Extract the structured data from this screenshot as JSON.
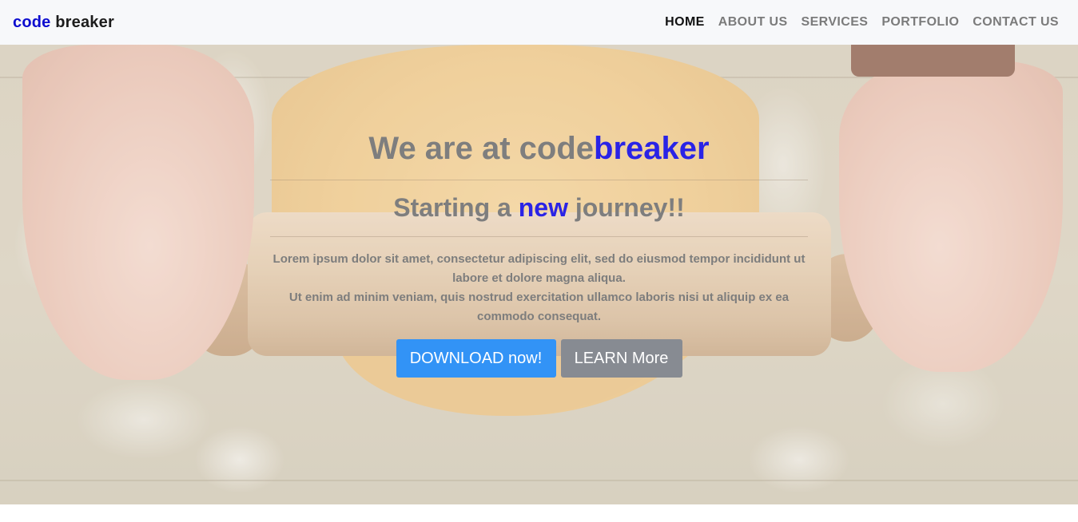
{
  "brand": {
    "part1": "code",
    "part2": "breaker"
  },
  "nav": [
    {
      "label": "HOME",
      "active": true
    },
    {
      "label": "ABOUT US",
      "active": false
    },
    {
      "label": "SERVICES",
      "active": false
    },
    {
      "label": "PORTFOLIO",
      "active": false
    },
    {
      "label": "CONTACT US",
      "active": false
    }
  ],
  "hero": {
    "heading_pre": "We are at code",
    "heading_accent": "breaker",
    "sub_pre": "Starting a ",
    "sub_accent": "new",
    "sub_post": " journey!!",
    "lead_line1": "Lorem ipsum dolor sit amet, consectetur adipiscing elit, sed do eiusmod tempor incididunt ut labore et dolore magna aliqua.",
    "lead_line2": "Ut enim ad minim veniam, quis nostrud exercitation ullamco laboris nisi ut aliquip ex ea commodo consequat.",
    "primary_button": "DOWNLOAD now!",
    "secondary_button": "LEARN More"
  },
  "colors": {
    "brand_accent": "#0d0dcf",
    "heading_accent": "#2a23e6",
    "primary_button": "#3293f6",
    "secondary_button": "#878b92",
    "navbar_bg": "#f7f8fa"
  }
}
